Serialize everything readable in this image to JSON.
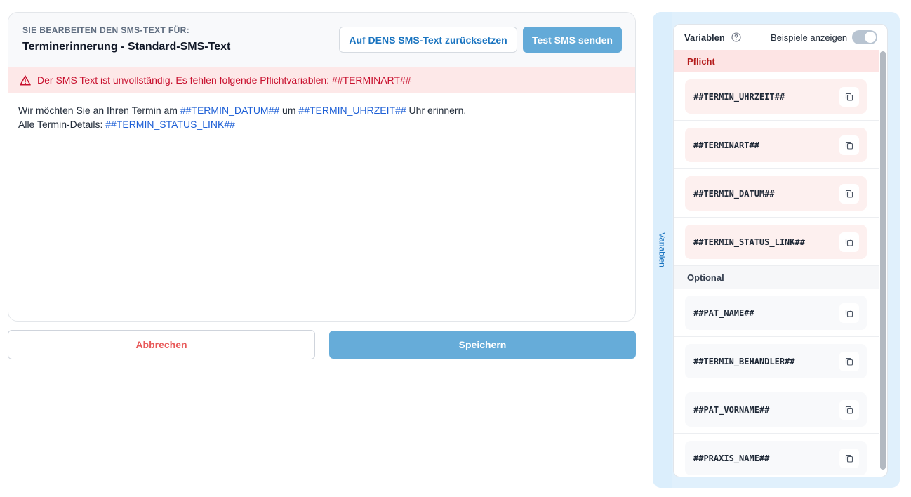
{
  "editor": {
    "eyebrow": "SIE BEARBEITEN DEN SMS-TEXT FÜR:",
    "title": "Terminerinnerung - Standard-SMS-Text",
    "reset_label": "Auf DENS SMS-Text zurücksetzen",
    "test_label": "Test SMS senden",
    "error_text": "Der SMS Text ist unvollständig. Es fehlen folgende Pflichtvariablen: ##TERMINART##",
    "body": {
      "line1_a": "Wir möchten Sie an Ihren Termin am ",
      "line1_var1": "##TERMIN_DATUM##",
      "line1_b": " um ",
      "line1_var2": "##TERMIN_UHRZEIT##",
      "line1_c": " Uhr erinnern.",
      "line2_a": "Alle Termin-Details: ",
      "line2_var": "##TERMIN_STATUS_LINK##"
    }
  },
  "actions": {
    "cancel_label": "Abbrechen",
    "save_label": "Speichern"
  },
  "variables_panel": {
    "tab_label": "Variablen",
    "header_label": "Variablen",
    "examples_label": "Beispiele anzeigen",
    "examples_toggle_on": false,
    "required_label": "Pflicht",
    "optional_label": "Optional",
    "required": [
      "##TERMIN_UHRZEIT##",
      "##TERMINART##",
      "##TERMIN_DATUM##",
      "##TERMIN_STATUS_LINK##"
    ],
    "optional": [
      "##PAT_NAME##",
      "##TERMIN_BEHANDLER##",
      "##PAT_VORNAME##",
      "##PRAXIS_NAME##"
    ]
  },
  "icons": {
    "error": "warning-triangle-icon",
    "help": "question-circle-icon",
    "copy": "copy-icon"
  },
  "colors": {
    "accent": "#1a74c0",
    "primary_button": "#63aad8",
    "error_text": "#c8102e",
    "error_bg": "#fde8e8",
    "variable_text": "#1d5fd6"
  }
}
